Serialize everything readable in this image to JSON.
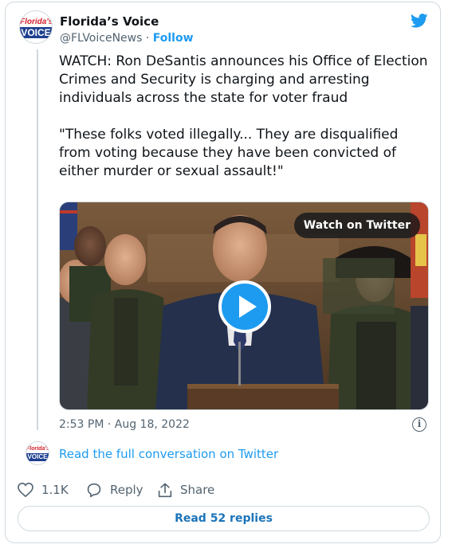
{
  "tweet": {
    "author_name": "Florida’s Voice",
    "handle": "@FLVoiceNews",
    "separator": " · ",
    "follow_label": "Follow",
    "avatar_line1": "Florida's",
    "avatar_line2": "VOICE",
    "text": "WATCH: Ron DeSantis announces his Office of Election Crimes and Security is charging and arresting individuals across the state for voter fraud\n\n\"These folks voted illegally... They are disqualified from voting because they have been convicted of either murder or sexual assault!\"",
    "media": {
      "watch_label": "Watch on Twitter",
      "play_icon": "play-icon"
    },
    "timestamp": "2:53 PM · Aug 18, 2022",
    "info_symbol": "i",
    "read_full_label": "Read the full conversation on Twitter",
    "actions": {
      "like_count": "1.1K",
      "reply_label": "Reply",
      "share_label": "Share"
    },
    "read_replies_label": "Read 52 replies"
  },
  "colors": {
    "brand_blue": "#1d9bf0",
    "text_gray": "#536471",
    "border": "#cfd9de"
  }
}
